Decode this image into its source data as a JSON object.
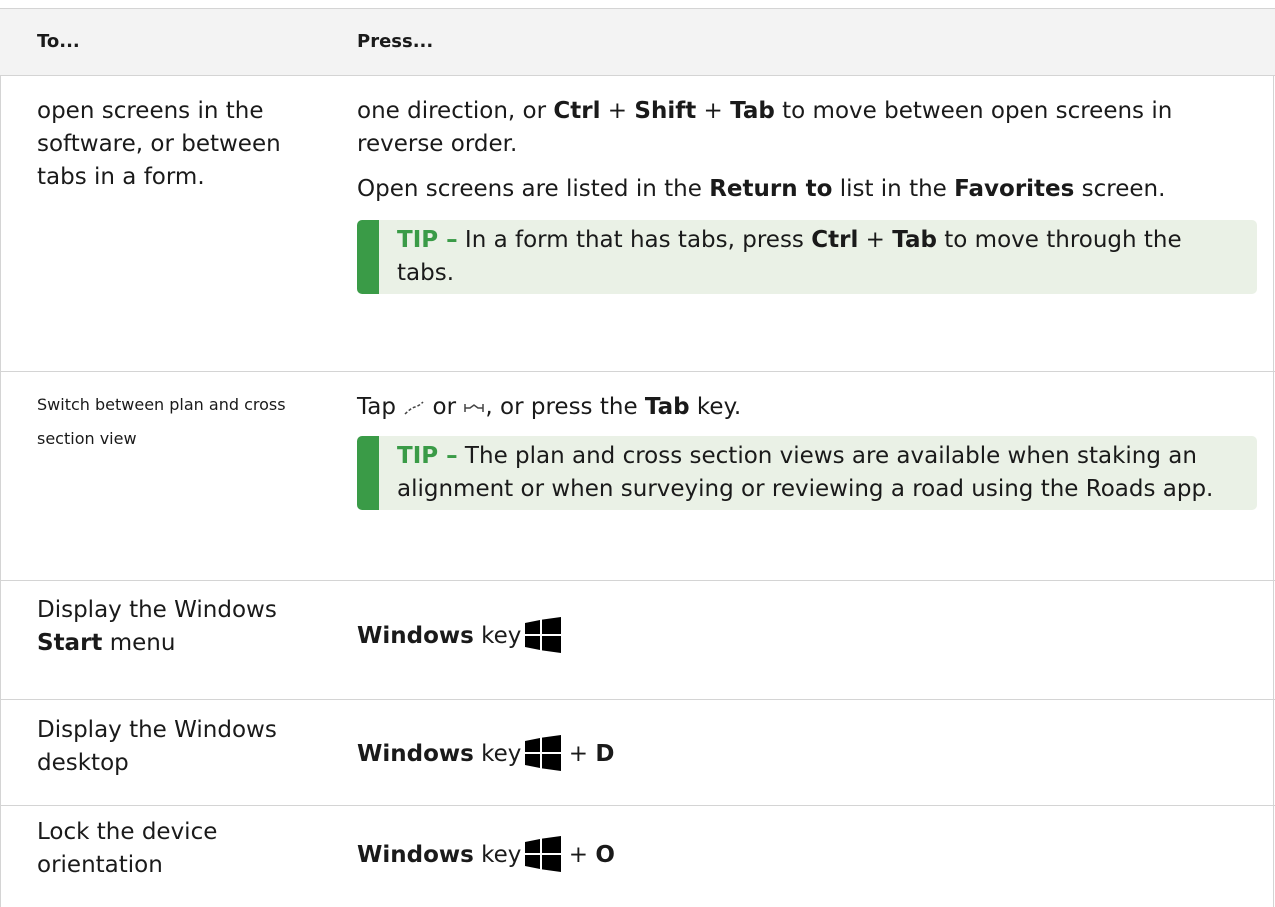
{
  "table": {
    "headers": {
      "to": "To...",
      "press": "Press..."
    },
    "row1": {
      "to": "open screens in the software, or between tabs in a form.",
      "p1_pre": "one direction, or ",
      "k_ctrl": "Ctrl",
      "plus1": " + ",
      "k_shift": "Shift",
      "plus2": " + ",
      "k_tab": "Tab",
      "p1_post": " to move between open screens in reverse order.",
      "p2_pre": "Open screens are listed in the ",
      "return_to": "Return to",
      "p2_mid": " list in the ",
      "favorites": "Favorites",
      "p2_post": " screen.",
      "tip_label": "TIP –",
      "tip_pre": " In a form that has tabs, press ",
      "tip_ctrl": "Ctrl",
      "tip_plus": " + ",
      "tip_tab": "Tab",
      "tip_post": " to move through the tabs."
    },
    "row2": {
      "to": "Switch between plan and cross section view",
      "p1_pre": "Tap ",
      "icon1": "plan-view-icon",
      "p1_or": " or ",
      "icon2": "cross-section-icon",
      "p1_mid": ", or press the ",
      "k_tab": "Tab",
      "p1_post": " key.",
      "tip_label": "TIP –",
      "tip_text": " The plan and cross section views are available when staking an alignment or when surveying or reviewing a road using the Roads app."
    },
    "row3": {
      "to_pre": "Display the Windows ",
      "to_start": "Start",
      "to_post": " menu",
      "k_windows": "Windows",
      "key_word": " key",
      "icon": "windows-logo-icon"
    },
    "row4": {
      "to": "Display the Windows desktop",
      "k_windows": "Windows",
      "key_word": " key",
      "plus": " + ",
      "letter": "D"
    },
    "row5": {
      "to": "Lock the device orientation",
      "k_windows": "Windows",
      "key_word": " key",
      "plus": " + ",
      "letter": "O"
    }
  },
  "colors": {
    "tip_accent": "#3a9b47",
    "tip_bg": "#eaf1e6",
    "header_bg": "#f3f3f3",
    "rule": "#d4d4d4"
  }
}
